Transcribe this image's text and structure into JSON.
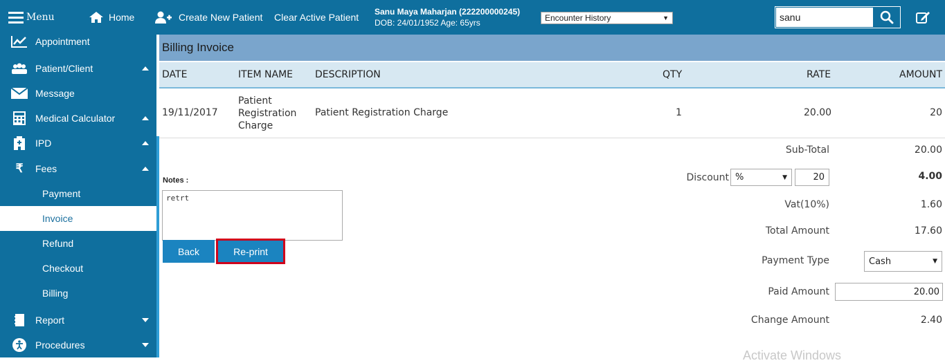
{
  "topbar": {
    "menu_label": "Menu",
    "home_label": "Home",
    "create_patient_label": "Create New Patient",
    "clear_patient_label": "Clear Active Patient",
    "patient_name": "Sanu Maya Maharjan (222200000245)",
    "patient_dob": "DOB: 24/01/1952 Age: 65yrs",
    "encounter_select": "Encounter History",
    "search_value": "sanu"
  },
  "sidebar": {
    "items": [
      {
        "label": "Appointment",
        "icon": "chart-line-icon"
      },
      {
        "label": "Patient/Client",
        "icon": "users-icon"
      },
      {
        "label": "Message",
        "icon": "envelope-icon"
      },
      {
        "label": "Medical Calculator",
        "icon": "calculator-icon"
      },
      {
        "label": "IPD",
        "icon": "hospital-icon"
      },
      {
        "label": "Fees",
        "icon": "rupee-icon"
      },
      {
        "label": "Report",
        "icon": "notebook-icon"
      },
      {
        "label": "Procedures",
        "icon": "accessibility-icon"
      }
    ],
    "fees_sub": [
      "Payment",
      "Invoice",
      "Refund",
      "Checkout",
      "Billing"
    ],
    "active_sub": "Invoice"
  },
  "invoice": {
    "title": "Billing Invoice",
    "columns": [
      "DATE",
      "ITEM NAME",
      "DESCRIPTION",
      "QTY",
      "RATE",
      "AMOUNT"
    ],
    "rows": [
      {
        "date": "19/11/2017",
        "item_name_lines": [
          "Patient",
          "Registration",
          "Charge"
        ],
        "description": "Patient Registration Charge",
        "qty": "1",
        "rate": "20.00",
        "amount": "20"
      }
    ],
    "notes_label": "Notes :",
    "notes_value": "retrt",
    "back_label": "Back",
    "reprint_label": "Re-print",
    "subtotal_label": "Sub-Total",
    "subtotal_value": "20.00",
    "discount_label": "Discount",
    "discount_type": "%",
    "discount_input": "20",
    "discount_value": "4.00",
    "vat_label": "Vat(10%)",
    "vat_value": "1.60",
    "total_label": "Total Amount",
    "total_value": "17.60",
    "payment_type_label": "Payment Type",
    "payment_type_value": "Cash",
    "paid_label": "Paid Amount",
    "paid_value": "20.00",
    "change_label": "Change Amount",
    "change_value": "2.40"
  },
  "watermark": "Activate Windows",
  "colors": {
    "topbar": "#0f6f9e",
    "accent": "#1b84c0",
    "highlight": "#d0021b"
  }
}
